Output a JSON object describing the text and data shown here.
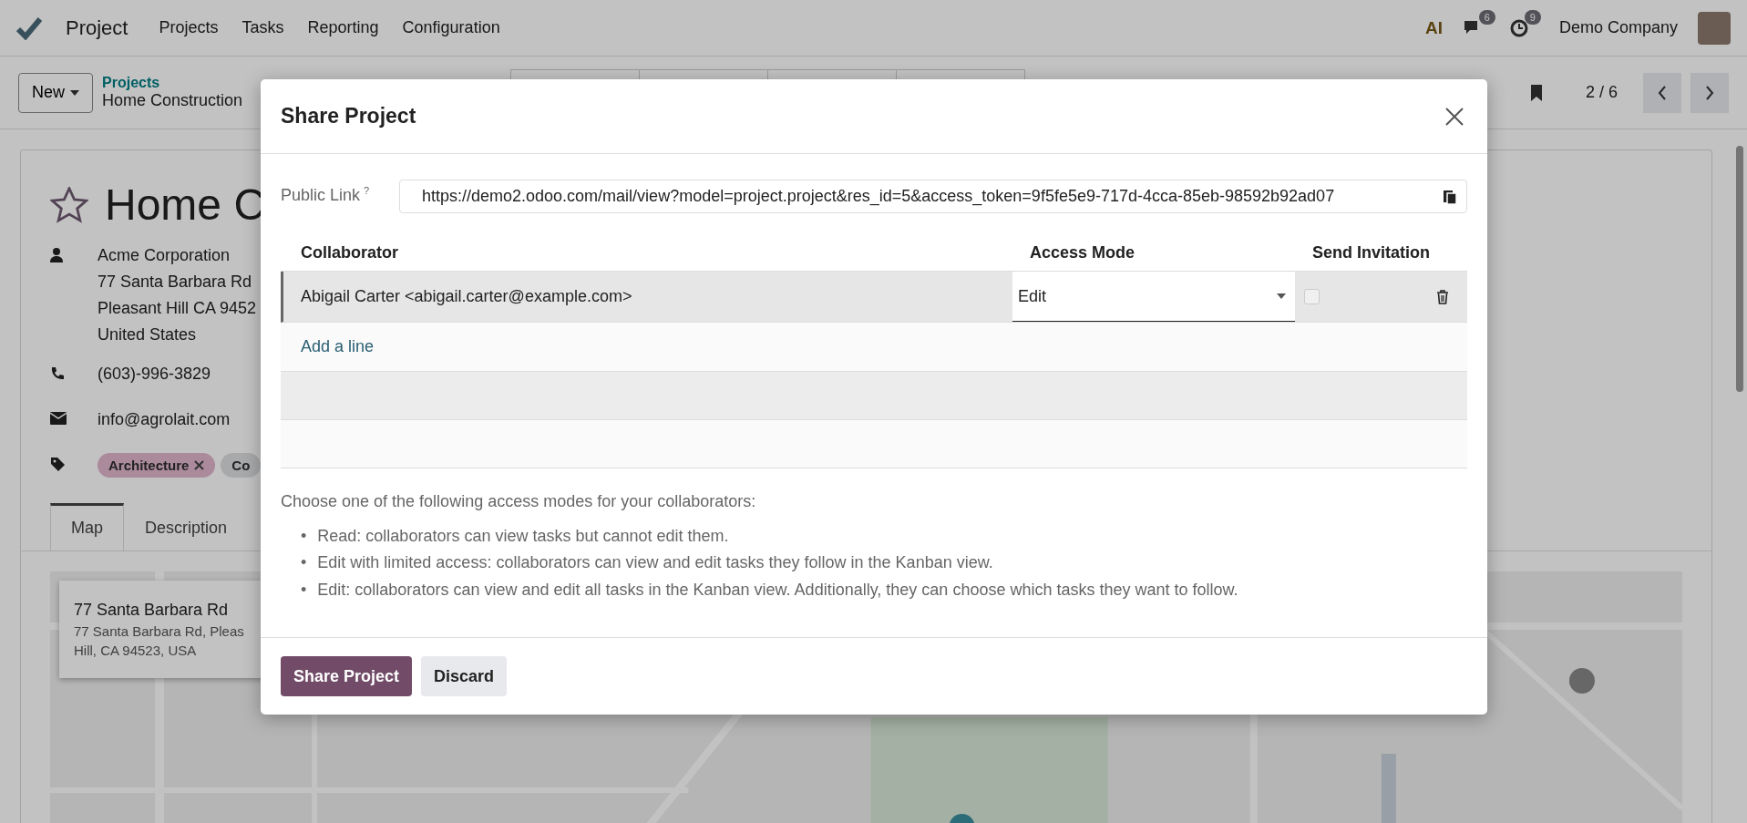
{
  "navbar": {
    "app": "Project",
    "menu": [
      "Projects",
      "Tasks",
      "Reporting",
      "Configuration"
    ],
    "ai_label": "AI",
    "messages_count": "6",
    "activities_count": "9",
    "company": "Demo Company"
  },
  "control_panel": {
    "new_button": "New",
    "breadcrumb_parent": "Projects",
    "breadcrumb_current": "Home Construction",
    "pager": "2 / 6"
  },
  "form": {
    "favorite": false,
    "title": "Home C",
    "customer": [
      "Acme Corporation",
      "77 Santa Barbara Rd",
      "Pleasant Hill CA 9452",
      "United States"
    ],
    "phone": "(603)-996-3829",
    "email": "info@agrolait.com",
    "tags": [
      {
        "label": "Architecture",
        "color": "#ab8a9b",
        "removable": true
      },
      {
        "label": "Co",
        "color": "#a7a9ab",
        "removable": false
      }
    ],
    "tabs": [
      {
        "label": "Map",
        "selected": true
      },
      {
        "label": "Description",
        "selected": false
      }
    ],
    "map": {
      "kind": "picture",
      "info_title": "77 Santa Barbara Rd",
      "info_address": "77 Santa Barbara Rd, Pleas",
      "info_address_2": "Hill, CA 94523, USA"
    }
  },
  "dialog": {
    "title": "Share Project",
    "public_link_label": "Public Link",
    "help_mark": "?",
    "public_link": "https://demo2.odoo.com/mail/view?model=project.project&res_id=5&access_token=9f5fe5e9-717d-4cca-85eb-98592b92ad07",
    "columns": [
      "Collaborator",
      "Access Mode",
      "Send Invitation"
    ],
    "rows": [
      {
        "collaborator": "Abigail Carter <abigail.carter@example.com>",
        "access_mode": "Edit",
        "send_invitation": false
      }
    ],
    "add_line": "Add a line",
    "intro": "Choose one of the following access modes for your collaborators:",
    "modes": [
      {
        "bullet": "•",
        "text": "Read: collaborators can view tasks but cannot edit them."
      },
      {
        "bullet": "•",
        "text": "Edit with limited access: collaborators can view and edit tasks they follow in the Kanban view."
      },
      {
        "bullet": "•",
        "text": "Edit: collaborators can view and edit all tasks in the Kanban view. Additionally, they can choose which tasks they want to follow."
      }
    ],
    "buttons": [
      {
        "label": "Share Project",
        "kind": "primary"
      },
      {
        "label": "Discard",
        "kind": "secondary"
      }
    ]
  }
}
